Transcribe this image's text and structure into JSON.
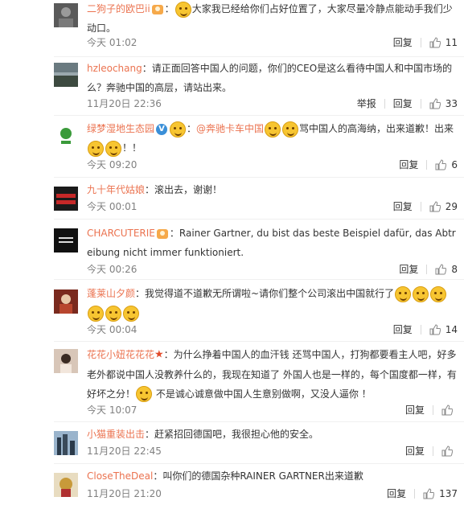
{
  "actions": {
    "reply": "回复",
    "report": "举报"
  },
  "comments": [
    {
      "user": "二狗子的欧巴ii",
      "badge": "vip",
      "text": "大家我已经给你们占好位置了，大家尽量冷静点能动手我们少动口。",
      "time": "今天 01:02",
      "likes": "11",
      "has_report": false
    },
    {
      "user": "hzleochang",
      "text": "：请正面回答中国人的问题，你们的CEO是这么看待中国人和中国市场的么？奔驰中国的高层，请站出来。",
      "time": "11月20日 22:36",
      "likes": "33",
      "has_report": true
    },
    {
      "user": "绿梦湿地生态园",
      "badge": "verified",
      "mention": "@奔驰卡车中国",
      "text_before": "：",
      "text_after": "骂中国人的高海纳，出来道歉！出来",
      "text_end": "！！",
      "time": "今天 09:20",
      "likes": "6",
      "has_report": false
    },
    {
      "user": "九十年代姑娘",
      "text": "：滚出去，谢谢！",
      "time": "今天 00:01",
      "likes": "29",
      "has_report": false
    },
    {
      "user": "CHARCUTERIE",
      "badge": "vip",
      "text": "：Rainer Gartner, du bist das beste Beispiel dafür, das Abtreibung nicht immer funktioniert.",
      "time": "今天 00:26",
      "likes": "8",
      "has_report": false
    },
    {
      "user": "蓬莱山夕颜",
      "text": "：我觉得道不道歉无所谓啦~请你们整个公司滚出中国就行了",
      "time": "今天 00:04",
      "likes": "14",
      "has_report": false
    },
    {
      "user": "花花小妞花花花",
      "badge": "star",
      "text_a": "：为什么挣着中国人的血汗钱 还骂中国人，打狗都要看主人吧，好多老外都说中国人没教养什么的，我现在知道了 外国人也是一样的，每个国度都一样，有好坏之分！",
      "text_b": " 不是诚心诚意做中国人生意别做啊，又没人逼你 ！",
      "time": "今天 10:07",
      "likes": "",
      "has_report": false
    },
    {
      "user": "小猫重装出击",
      "text": "：赶紧招回德国吧，我很担心他的安全。",
      "time": "11月20日 22:45",
      "likes": "",
      "has_report": false
    },
    {
      "user": "CloseTheDeal",
      "text": "：叫你们的德国杂种RAINER GARTNER出来道歉",
      "time": "11月20日 21:20",
      "likes": "137",
      "has_report": false
    }
  ]
}
